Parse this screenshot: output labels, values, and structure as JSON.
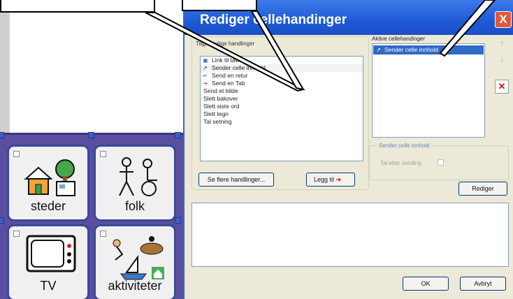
{
  "dialog": {
    "title": "Rediger cellehandinger",
    "close_label": "X",
    "available_legend": "Tilgjengelige handlinger",
    "available_items": [
      {
        "label": "Link til tavle",
        "icon": "link-board-icon"
      },
      {
        "label": "Sender celle innhold",
        "icon": "send-content-icon"
      },
      {
        "label": "Send en retur",
        "icon": "return-icon"
      },
      {
        "label": "Send en Tab",
        "icon": "tab-icon"
      },
      {
        "label": "Send et bilde",
        "icon": ""
      },
      {
        "label": "Slett bakover",
        "icon": ""
      },
      {
        "label": "Slett siste ord",
        "icon": ""
      },
      {
        "label": "Slett tegn",
        "icon": ""
      },
      {
        "label": "Tal setning",
        "icon": ""
      }
    ],
    "more_actions_label": "Se flere handlinger...",
    "add_label": "Legg til",
    "active_legend": "Aktive cellehandinger",
    "active_items": [
      "Sender celle innhold"
    ],
    "selected_group_title": "Sender celle innhold",
    "speak_after_label": "Tal etter sending",
    "edit_label": "Rediger",
    "ok_label": "OK",
    "cancel_label": "Avbryt"
  },
  "grid": {
    "cells": [
      {
        "label": "steder"
      },
      {
        "label": "folk"
      },
      {
        "label": "TV"
      },
      {
        "label": "aktiviteter"
      }
    ]
  }
}
